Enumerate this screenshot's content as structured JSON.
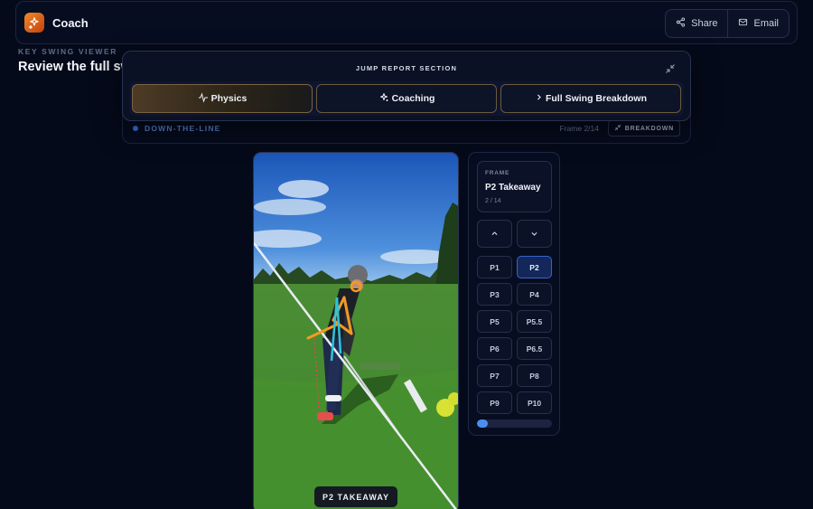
{
  "app": {
    "name": "Coach"
  },
  "header": {
    "share_label": "Share",
    "email_label": "Email"
  },
  "page": {
    "eyebrow": "KEY SWING VIEWER",
    "title": "Review the full sw"
  },
  "jump": {
    "title": "JUMP REPORT SECTION",
    "tabs": [
      {
        "label": "Physics",
        "icon": "activity-icon",
        "active": true
      },
      {
        "label": "Coaching",
        "icon": "sparkles-icon",
        "active": false
      },
      {
        "label": "Full Swing Breakdown",
        "icon": "chevron-right-icon",
        "active": false
      }
    ]
  },
  "view": {
    "label": "DOWN-THE-LINE",
    "frame_text": "Frame 2/14",
    "breakdown_label": "BREAKDOWN"
  },
  "video": {
    "caption": "P2 TAKEAWAY"
  },
  "frame": {
    "label": "FRAME",
    "title": "P2 Takeaway",
    "count": "2 / 14",
    "positions": [
      "P1",
      "P2",
      "P3",
      "P4",
      "P5",
      "P5.5",
      "P6",
      "P6.5",
      "P7",
      "P8",
      "P9",
      "P10"
    ],
    "active": "P2",
    "progress": 0.143
  },
  "colors": {
    "accent": "#4b8ef2",
    "brand": "#e8792a",
    "gold": "#7a6341"
  }
}
